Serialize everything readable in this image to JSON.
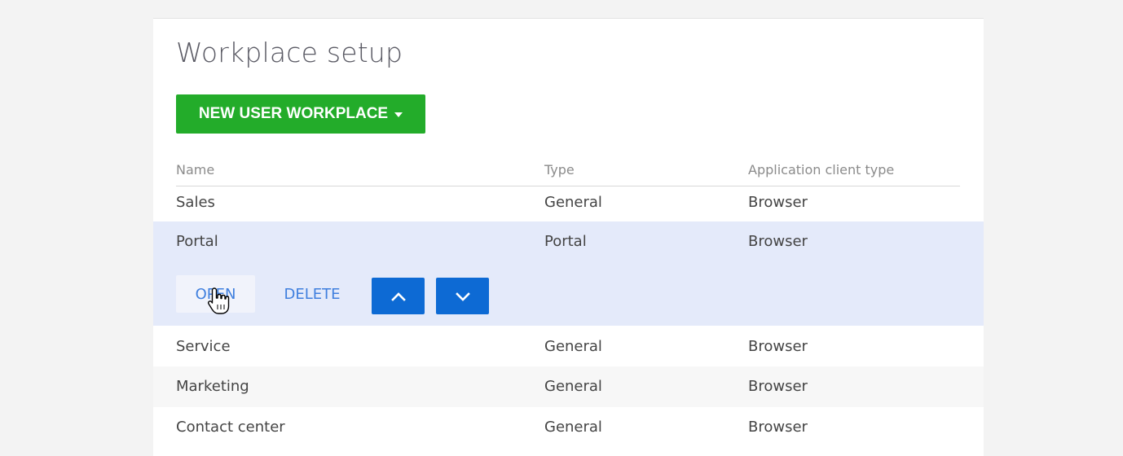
{
  "page": {
    "title": "Workplace setup"
  },
  "toolbar": {
    "new_button_label": "NEW USER WORKPLACE",
    "new_button_icon": "chevron-down-icon"
  },
  "colors": {
    "primary_green": "#23ac2a",
    "selected_row_bg": "#e4eafa",
    "action_blue": "#3f7fde",
    "arrow_button_bg": "#0d6ad4"
  },
  "table": {
    "headers": {
      "name": "Name",
      "type": "Type",
      "client_type": "Application client type"
    },
    "rows": [
      {
        "name": "Sales",
        "type": "General",
        "client_type": "Browser"
      },
      {
        "name": "Portal",
        "type": "Portal",
        "client_type": "Browser",
        "selected": true
      },
      {
        "name": "Service",
        "type": "General",
        "client_type": "Browser"
      },
      {
        "name": "Marketing",
        "type": "General",
        "client_type": "Browser"
      },
      {
        "name": "Contact center",
        "type": "General",
        "client_type": "Browser"
      }
    ]
  },
  "row_actions": {
    "open_label": "OPEN",
    "delete_label": "DELETE",
    "move_up_icon": "chevron-up-icon",
    "move_down_icon": "chevron-down-icon"
  }
}
